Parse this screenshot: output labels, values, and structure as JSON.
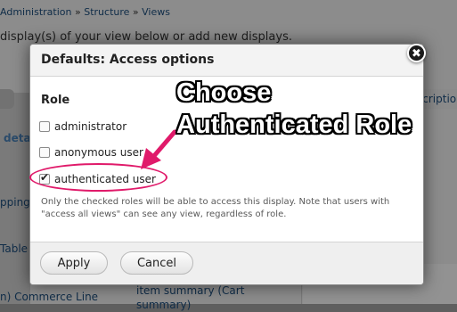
{
  "background": {
    "breadcrumb": [
      "Administration",
      "Structure",
      "Views"
    ],
    "breadcrumb_sep": "»",
    "intro": "display(s) of your view below or add new displays.",
    "right_tab": "description",
    "left_fragments": [
      "deta",
      "pping",
      "Table",
      "n) Commerce Line"
    ],
    "lower_link": "item summary (Cart summary)"
  },
  "dialog": {
    "title": "Defaults: Access options",
    "close_glyph": "✖",
    "role_heading": "Role",
    "roles": [
      {
        "label": "administrator",
        "checked": false
      },
      {
        "label": "anonymous user",
        "checked": false
      },
      {
        "label": "authenticated user",
        "checked": true
      }
    ],
    "help_text": "Only the checked roles will be able to access this display. Note that users with \"access all views\" can see any view, regardless of role.",
    "apply_label": "Apply",
    "cancel_label": "Cancel"
  },
  "annotation": {
    "line1": "Choose",
    "line2": "Authenticated Role",
    "color": "#e01a6a"
  }
}
